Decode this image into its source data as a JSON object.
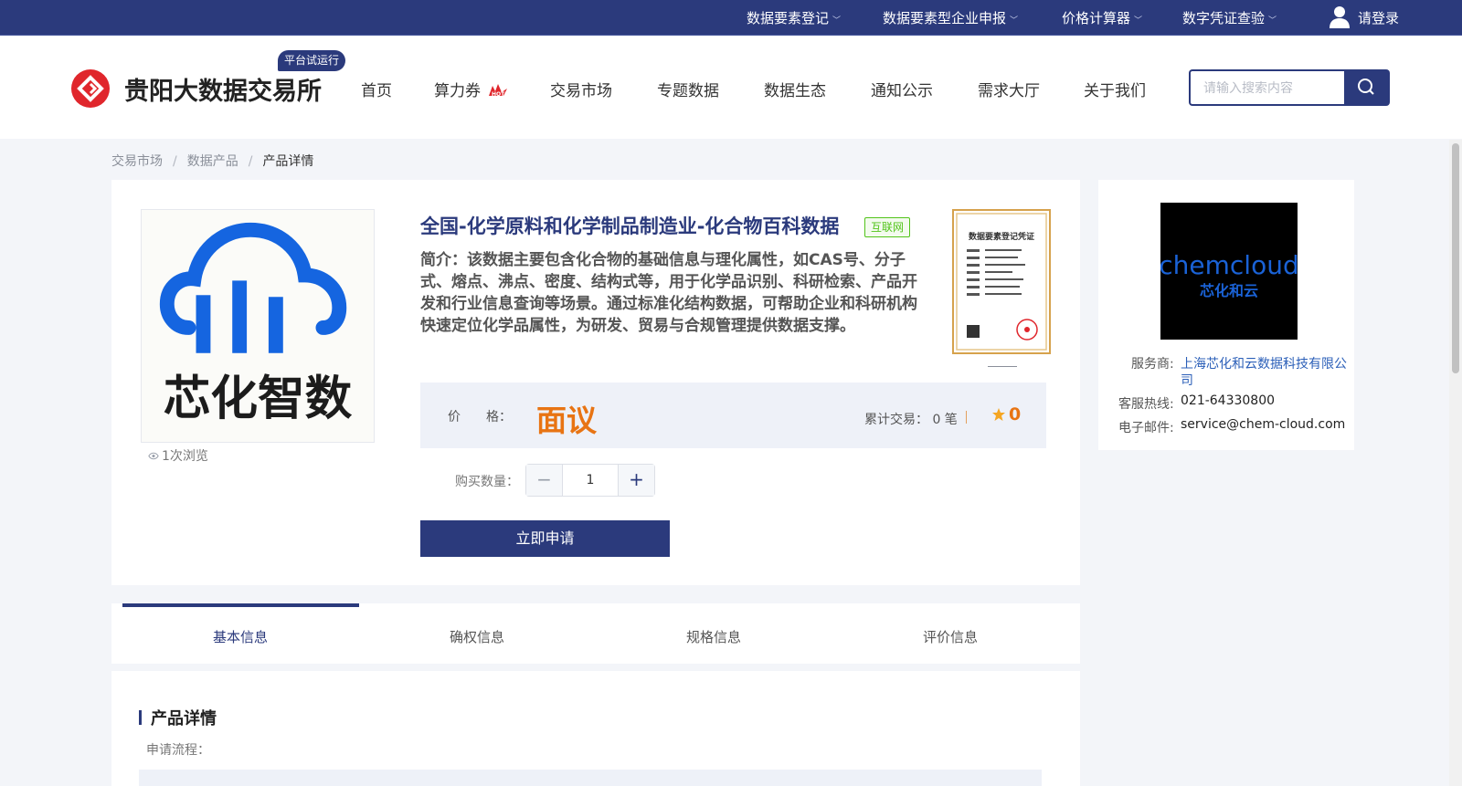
{
  "topbar": {
    "links": [
      {
        "label": "数据要素登记"
      },
      {
        "label": "数据要素型企业申报"
      },
      {
        "label": "价格计算器"
      },
      {
        "label": "数字凭证查验"
      }
    ],
    "login": "请登录"
  },
  "header": {
    "logo_text": "贵阳大数据交易所",
    "badge": "平台试运行",
    "nav": [
      "首页",
      "算力券",
      "交易市场",
      "专题数据",
      "数据生态",
      "通知公示",
      "需求大厅",
      "关于我们"
    ],
    "hot_badge": "HOT",
    "search_placeholder": "请输入搜索内容"
  },
  "breadcrumb": [
    "交易市场",
    "数据产品",
    "产品详情"
  ],
  "product": {
    "image_text": "芯化智数",
    "views": "1次浏览",
    "title": "全国-化学原料和化学制品制造业-化合物百科数据",
    "tag": "互联网",
    "intro": "简介：该数据主要包含化合物的基础信息与理化属性，如CAS号、分子式、熔点、沸点、密度、结构式等，用于化学品识别、科研检索、产品开发和行业信息查询等场景。通过标准化结构数据，可帮助企业和科研机构快速定位化学品属性，为研发、贸易与合规管理提供数据支撑。",
    "certificate_title": "数据要素登记凭证",
    "price_label": "价　　格：",
    "price_value": "面议",
    "trade_label": "累计交易：",
    "trade_value": "0 笔",
    "score": "0",
    "qty_label": "购买数量：",
    "qty_value": "1",
    "apply_button": "立即申请"
  },
  "provider": {
    "logo_text": "chemcloud",
    "logo_sub": "芯化和云",
    "service_label": "服务商:",
    "service_value_line1": "上海芯化和云数据科技有限公",
    "service_value_line2": "司",
    "hotline_label": "客服热线:",
    "hotline_value": "021-64330800",
    "email_label": "电子邮件:",
    "email_value": "service@chem-cloud.com"
  },
  "tabs": [
    "基本信息",
    "确权信息",
    "规格信息",
    "评价信息"
  ],
  "details": {
    "title": "产品详情",
    "flow_label": "申请流程："
  },
  "colors": {
    "brand": "#2b3a7c",
    "price": "#e87413",
    "tag": "#52c41a"
  }
}
